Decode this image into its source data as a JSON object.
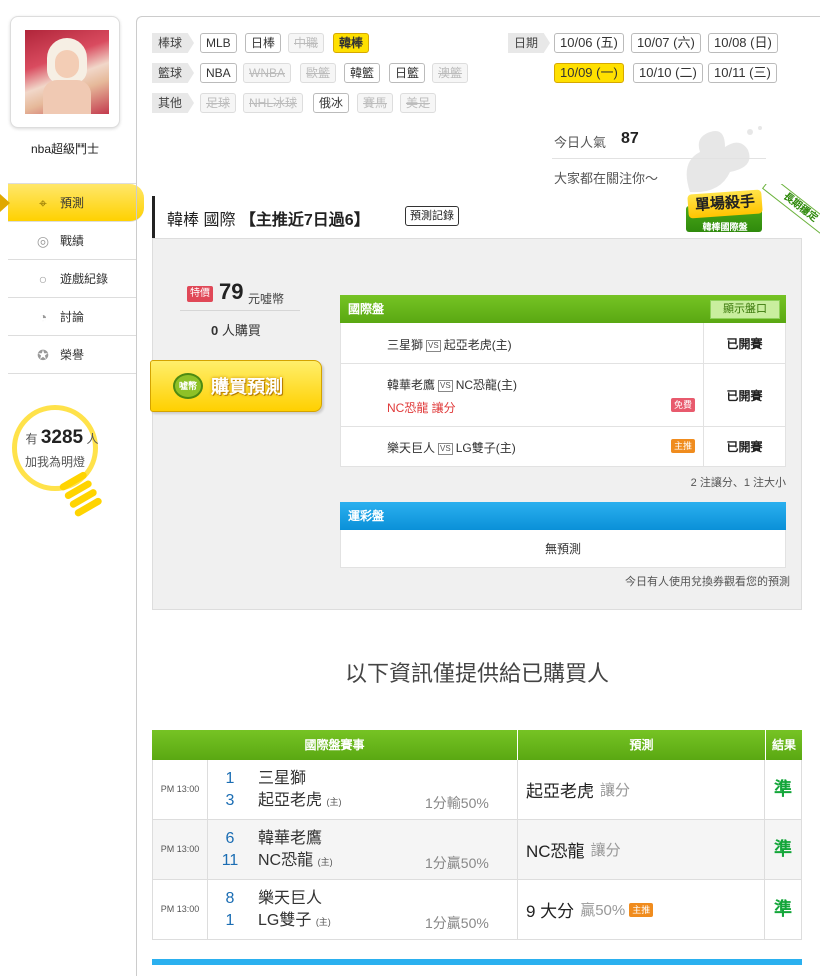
{
  "profile": {
    "username": "nba超級鬥士"
  },
  "nav": [
    {
      "label": "預測",
      "icon": "crosshair-icon",
      "active": true
    },
    {
      "label": "戰績",
      "icon": "chart-icon"
    },
    {
      "label": "遊戲紀錄",
      "icon": "ring-icon"
    },
    {
      "label": "討論",
      "icon": "chat-icon"
    },
    {
      "label": "榮譽",
      "icon": "medal-icon"
    }
  ],
  "lamp": {
    "prefix": "有",
    "count": "3285",
    "suffix": "人",
    "label": "加我為明燈"
  },
  "filters": {
    "baseball": {
      "label": "棒球",
      "items": [
        "MLB",
        "日棒",
        "中職",
        "韓棒"
      ]
    },
    "basketball": {
      "label": "籃球",
      "items": [
        "NBA",
        "WNBA",
        "歐籃",
        "韓籃",
        "日籃",
        "澳籃"
      ]
    },
    "other": {
      "label": "其他",
      "items": [
        "足球",
        "NHL冰球",
        "俄冰",
        "賽馬",
        "美足"
      ]
    }
  },
  "dates": {
    "label": "日期",
    "items": [
      "10/06 (五)",
      "10/07 (六)",
      "10/08 (日)",
      "10/09 (一)",
      "10/10 (二)",
      "10/11 (三)"
    ],
    "selected": "10/09 (一)"
  },
  "popularity": {
    "label": "今日人氣",
    "value": "87",
    "message": "大家都在關注你〜"
  },
  "title": {
    "league": "韓棒 國際",
    "streak": "【主推近7日過6】",
    "record_button": "預測記錄"
  },
  "badges": {
    "killer": "單場殺手",
    "killer_sub": "韓棒國際盤",
    "corner": "長期穩定"
  },
  "purchase": {
    "tag": "特價",
    "price": "79",
    "unit": "元噓幣",
    "buyers": "0",
    "buyers_suffix": "人購買",
    "button": "購買預測",
    "coin": "噓幣"
  },
  "intl_table": {
    "title": "國際盤",
    "show_button": "顯示盤口",
    "rows": [
      {
        "away": "三星獅",
        "home": "起亞老虎(主)",
        "pick": "",
        "badge": "",
        "status": "已開賽"
      },
      {
        "away": "韓華老鷹",
        "home": "NC恐龍(主)",
        "pick": "NC恐龍  讓分",
        "badge": "免費",
        "status": "已開賽"
      },
      {
        "away": "樂天巨人",
        "home": "LG雙子(主)",
        "pick": "",
        "badge": "主推",
        "status": "已開賽"
      }
    ],
    "note": "2 注讓分、1 注大小"
  },
  "lottery": {
    "title": "運彩盤",
    "empty": "無預測",
    "coupon_note": "今日有人使用兌換券觀看您的預測"
  },
  "info_heading": "以下資訊僅提供給已購買人",
  "result_table": {
    "headers": [
      "國際盤賽事",
      "預測",
      "結果"
    ],
    "rows": [
      {
        "time": "PM 13:00",
        "away_no": "1",
        "away": "三星獅",
        "home_no": "3",
        "home": "起亞老虎",
        "home_tag": "(主)",
        "odds": "1分輸50%",
        "pick": "起亞老虎",
        "pick_type": "讓分",
        "pick_odds": "",
        "badge": "",
        "result": "準"
      },
      {
        "time": "PM 13:00",
        "away_no": "6",
        "away": "韓華老鷹",
        "home_no": "11",
        "home": "NC恐龍",
        "home_tag": "(主)",
        "odds": "1分贏50%",
        "pick": "NC恐龍",
        "pick_type": "讓分",
        "pick_odds": "",
        "badge": "",
        "result": "準"
      },
      {
        "time": "PM 13:00",
        "away_no": "8",
        "away": "樂天巨人",
        "home_no": "1",
        "home": "LG雙子",
        "home_tag": "(主)",
        "odds": "1分贏50%",
        "pick": "9 大分",
        "pick_type": "",
        "pick_odds": "贏50%",
        "badge": "主推",
        "result": "準"
      }
    ]
  },
  "colors": {
    "accent_yellow": "#ffe000",
    "green": "#5aa812",
    "blue": "#0a90d8",
    "red": "#e03a3a"
  }
}
